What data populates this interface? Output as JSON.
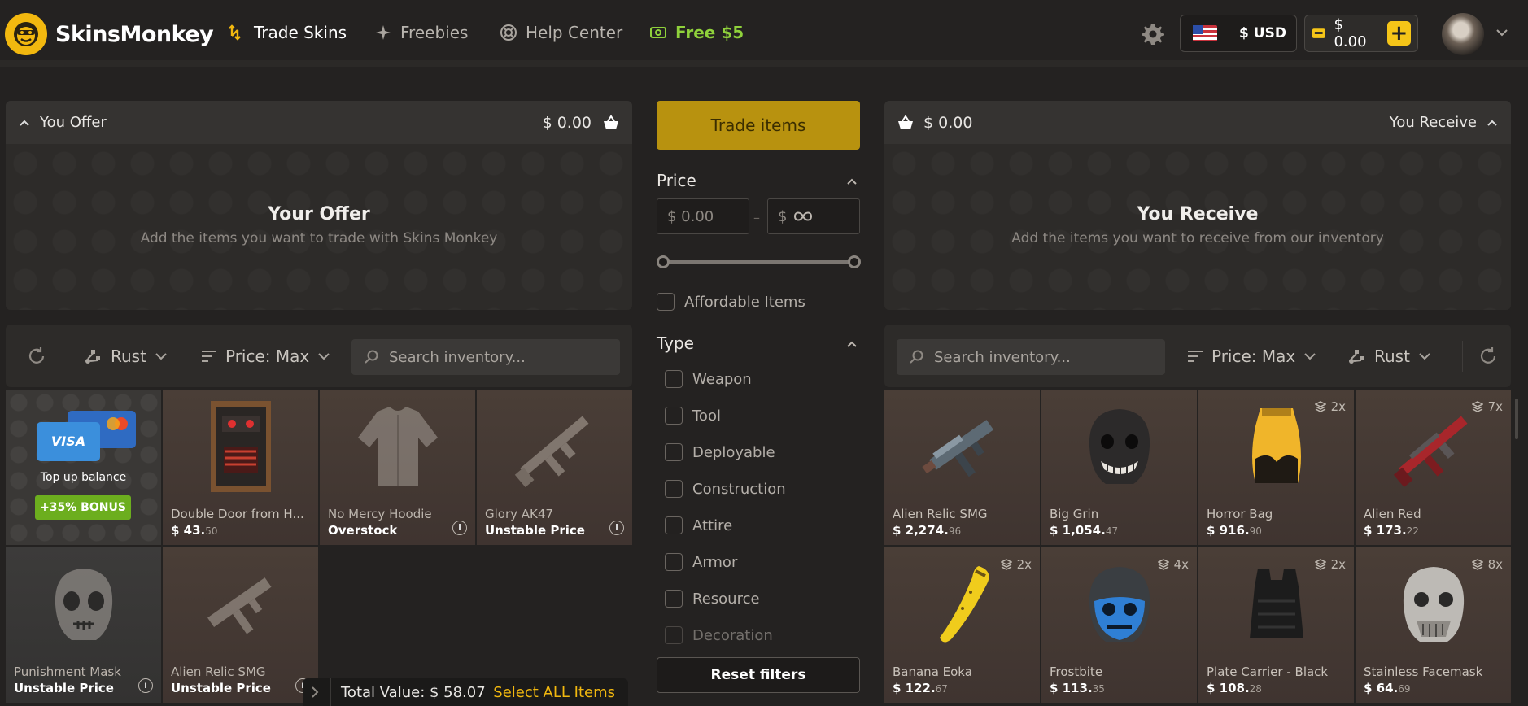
{
  "brand": {
    "name": "SkinsMonkey"
  },
  "nav": {
    "trade": "Trade Skins",
    "freebies": "Freebies",
    "help": "Help Center",
    "free": "Free $5"
  },
  "header": {
    "currency": "$ USD",
    "balance": "$ 0.00"
  },
  "offer": {
    "label": "You Offer",
    "total": "$ 0.00",
    "empty_title": "Your Offer",
    "empty_sub": "Add the items you want to trade with Skins Monkey"
  },
  "receive": {
    "label": "You Receive",
    "total": "$ 0.00",
    "empty_title": "You Receive",
    "empty_sub": "Add the items you want to receive from our inventory"
  },
  "left_toolbar": {
    "game": "Rust",
    "sort": "Price: Max",
    "search_placeholder": "Search inventory..."
  },
  "right_toolbar": {
    "game": "Rust",
    "sort": "Price: Max",
    "search_placeholder": "Search inventory..."
  },
  "topup": {
    "label": "Top up balance",
    "bonus": "+35% BONUS",
    "card_brand": "VISA"
  },
  "left_items": [
    {
      "name": "Double Door from H...",
      "price_main": "$ 43.",
      "price_cents": "50"
    },
    {
      "name": "No Mercy Hoodie",
      "status": "Overstock"
    },
    {
      "name": "Glory AK47",
      "status": "Unstable Price"
    },
    {
      "name": "Punishment Mask",
      "status": "Unstable Price"
    },
    {
      "name": "Alien Relic SMG",
      "status": "Unstable Price"
    }
  ],
  "right_items": [
    {
      "name": "Alien Relic SMG",
      "price_main": "$ 2,274.",
      "price_cents": "96",
      "qty": ""
    },
    {
      "name": "Big Grin",
      "price_main": "$ 1,054.",
      "price_cents": "47",
      "qty": ""
    },
    {
      "name": "Horror Bag",
      "price_main": "$ 916.",
      "price_cents": "90",
      "qty": "2x"
    },
    {
      "name": "Alien Red",
      "price_main": "$ 173.",
      "price_cents": "22",
      "qty": "7x"
    },
    {
      "name": "Banana Eoka",
      "price_main": "$ 122.",
      "price_cents": "67",
      "qty": "2x"
    },
    {
      "name": "Frostbite",
      "price_main": "$ 113.",
      "price_cents": "35",
      "qty": "4x"
    },
    {
      "name": "Plate Carrier - Black",
      "price_main": "$ 108.",
      "price_cents": "28",
      "qty": "2x"
    },
    {
      "name": "Stainless Facemask",
      "price_main": "$ 64.",
      "price_cents": "69",
      "qty": "8x"
    }
  ],
  "filters": {
    "trade_button": "Trade items",
    "price_title": "Price",
    "price_min": "$ 0.00",
    "price_max_prefix": "$",
    "affordable": "Affordable Items",
    "type_title": "Type",
    "types": [
      "Weapon",
      "Tool",
      "Deployable",
      "Construction",
      "Attire",
      "Armor",
      "Resource",
      "Decoration"
    ],
    "reset": "Reset filters"
  },
  "footer": {
    "total_label": "Total Value: $ 58.07",
    "select_all": "Select ALL Items"
  }
}
